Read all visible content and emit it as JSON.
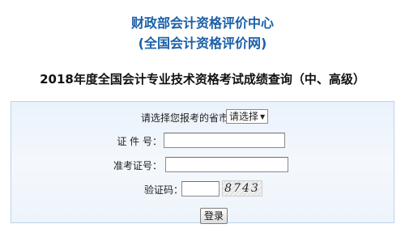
{
  "header": {
    "org_name": "财政部会计资格评价中心",
    "org_sub": "(全国会计资格评价网)",
    "exam_title": "2018年度全国会计专业技术资格考试成绩查询（中、高级）"
  },
  "form": {
    "province": {
      "label": "请选择您报考的省市：",
      "selected": "请选择",
      "arrow": "▼"
    },
    "id_number": {
      "label": "证 件 号：",
      "value": ""
    },
    "admission_number": {
      "label": "准考证号：",
      "value": ""
    },
    "captcha": {
      "label": "验证码：",
      "value": "",
      "image_text": "8743"
    },
    "login_label": "登录"
  },
  "colors": {
    "header_blue": "#1a5fa8",
    "panel_border": "#bcd3ea",
    "panel_bg": "#eef4fb"
  }
}
